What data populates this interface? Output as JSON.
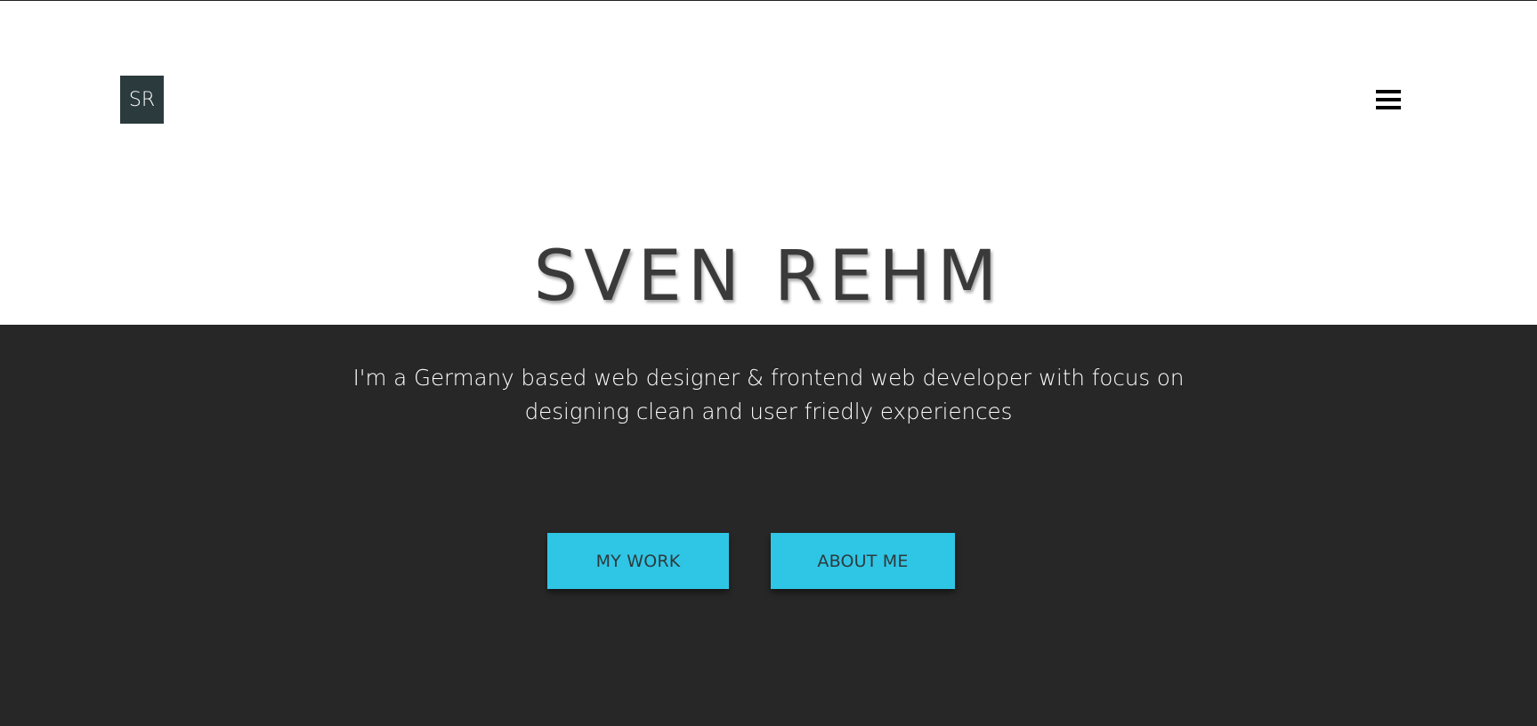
{
  "header": {
    "logo_text": "SR"
  },
  "hero": {
    "title": "SVEN REHM",
    "tagline": "I'm a Germany based web designer & frontend web developer with focus on designing clean and user friedly experiences"
  },
  "actions": {
    "my_work_label": "MY WORK",
    "about_me_label": "ABOUT ME"
  },
  "colors": {
    "dark_section": "#272727",
    "accent": "#2fc6e6",
    "logo_bg": "#2b3a3d"
  },
  "icons": {
    "menu": "hamburger-menu-icon"
  }
}
